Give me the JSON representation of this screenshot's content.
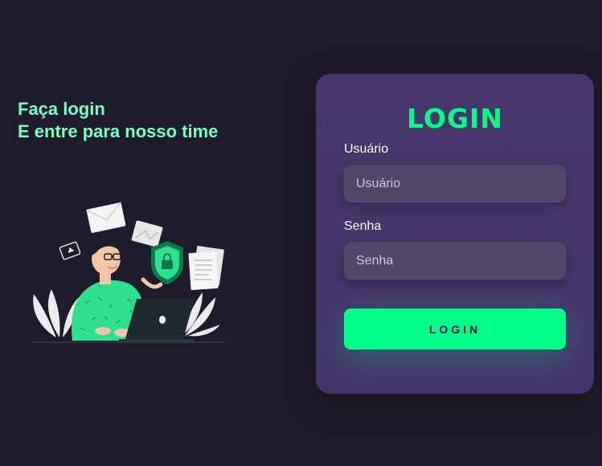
{
  "left": {
    "headline_line1": "Faça login",
    "headline_line2": "E entre para nosso time",
    "illustration": "person-with-laptop-security-illustration"
  },
  "card": {
    "title": "LOGIN",
    "username": {
      "label": "Usuário",
      "placeholder": "Usuário",
      "value": ""
    },
    "password": {
      "label": "Senha",
      "placeholder": "Senha",
      "value": ""
    },
    "button_label": "LOGIN"
  },
  "colors": {
    "background": "#201b2c",
    "card": "#463669",
    "accent": "#00ff88",
    "headline": "#77ffc0",
    "input_bg": "#514869"
  }
}
